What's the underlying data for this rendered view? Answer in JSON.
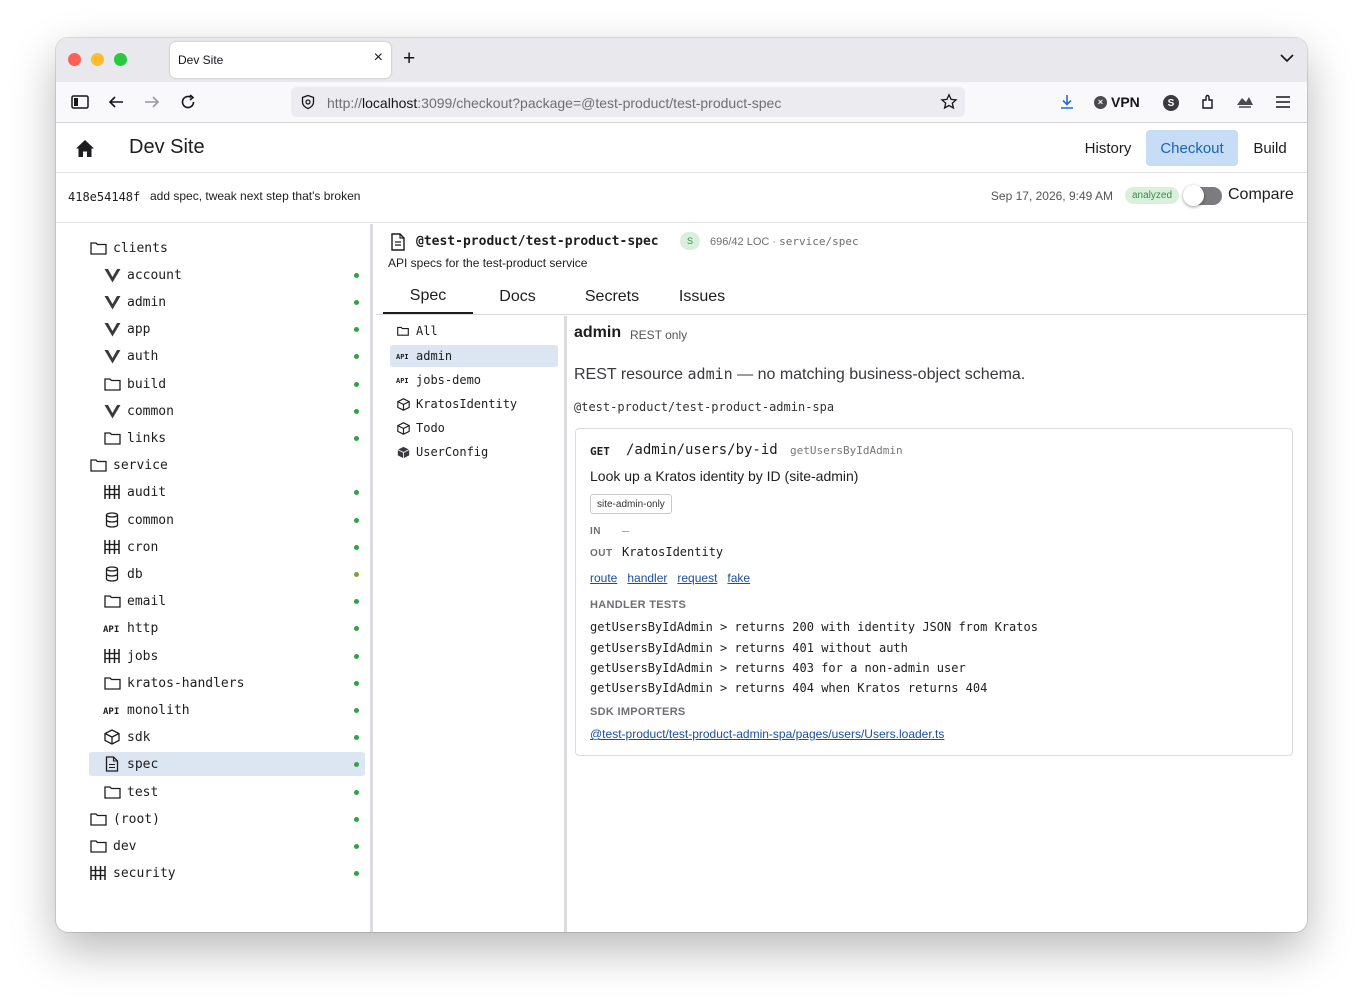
{
  "browser": {
    "tab_title": "Dev Site",
    "tab_close": "×",
    "new_tab": "+",
    "url_prefix": "http://",
    "url_host": "localhost",
    "url_rest": ":3099/checkout?package=@test-product/test-product-spec",
    "vpn_label": "VPN",
    "vpn_glyph": "×",
    "avatar_letter": "S"
  },
  "header": {
    "title": "Dev Site",
    "nav": [
      {
        "label": "History"
      },
      {
        "label": "Checkout",
        "active": true
      },
      {
        "label": "Build"
      }
    ]
  },
  "commit": {
    "sha": "418e54148f",
    "message": "add spec, tweak next step that's broken",
    "date": "Sep 17, 2026, 9:49 AM",
    "status": "analyzed",
    "compare_label": "Compare",
    "compare_enabled": false
  },
  "tree": [
    {
      "label": "clients",
      "icon": "folder-icon",
      "level": 0,
      "dot": false
    },
    {
      "label": "account",
      "icon": "vue-icon",
      "level": 1,
      "dot": true
    },
    {
      "label": "admin",
      "icon": "vue-icon",
      "level": 1,
      "dot": true
    },
    {
      "label": "app",
      "icon": "vue-icon",
      "level": 1,
      "dot": true
    },
    {
      "label": "auth",
      "icon": "vue-icon",
      "level": 1,
      "dot": true
    },
    {
      "label": "build",
      "icon": "folder-icon",
      "level": 1,
      "dot": true
    },
    {
      "label": "common",
      "icon": "vue-icon",
      "level": 1,
      "dot": true
    },
    {
      "label": "links",
      "icon": "folder-icon",
      "level": 1,
      "dot": true
    },
    {
      "label": "service",
      "icon": "folder-icon",
      "level": 0,
      "dot": false
    },
    {
      "label": "audit",
      "icon": "columns-icon",
      "level": 1,
      "dot": true
    },
    {
      "label": "common",
      "icon": "database-icon",
      "level": 1,
      "dot": true
    },
    {
      "label": "cron",
      "icon": "columns-icon",
      "level": 1,
      "dot": true
    },
    {
      "label": "db",
      "icon": "database-icon",
      "level": 1,
      "dot": true,
      "olive": true
    },
    {
      "label": "email",
      "icon": "folder-icon",
      "level": 1,
      "dot": true
    },
    {
      "label": "http",
      "icon": "api-icon",
      "level": 1,
      "dot": true
    },
    {
      "label": "jobs",
      "icon": "columns-icon",
      "level": 1,
      "dot": true
    },
    {
      "label": "kratos-handlers",
      "icon": "folder-icon",
      "level": 1,
      "dot": true
    },
    {
      "label": "monolith",
      "icon": "api-icon",
      "level": 1,
      "dot": true
    },
    {
      "label": "sdk",
      "icon": "cube-icon",
      "level": 1,
      "dot": true
    },
    {
      "label": "spec",
      "icon": "file-icon",
      "level": 1,
      "dot": true,
      "selected": true
    },
    {
      "label": "test",
      "icon": "folder-icon",
      "level": 1,
      "dot": true
    },
    {
      "label": "(root)",
      "icon": "folder-icon",
      "level": 0,
      "dot": true
    },
    {
      "label": "dev",
      "icon": "folder-icon",
      "level": 0,
      "dot": true
    },
    {
      "label": "security",
      "icon": "columns-icon",
      "level": 0,
      "dot": true
    }
  ],
  "package": {
    "name": "@test-product/test-product-spec",
    "badge": "S",
    "loc": "696/42 LOC",
    "sep": " · ",
    "path": "service/spec",
    "description": "API specs for the test-product service",
    "tabs": [
      {
        "label": "Spec",
        "active": true
      },
      {
        "label": "Docs"
      },
      {
        "label": "Secrets"
      },
      {
        "label": "Issues"
      }
    ]
  },
  "spec_list": [
    {
      "label": "All",
      "icon": "folder-icon"
    },
    {
      "label": "admin",
      "icon": "api-icon",
      "selected": true
    },
    {
      "label": "jobs-demo",
      "icon": "api-icon"
    },
    {
      "label": "KratosIdentity",
      "icon": "cube-outline-icon"
    },
    {
      "label": "Todo",
      "icon": "cube-outline-icon"
    },
    {
      "label": "UserConfig",
      "icon": "cube-solid-icon"
    }
  ],
  "resource": {
    "name": "admin",
    "subtitle": "REST only",
    "msg_pre": "REST resource ",
    "msg_code": "admin",
    "msg_post": " — no matching business-object schema.",
    "package": "@test-product/test-product-admin-spa"
  },
  "endpoint": {
    "method": "GET",
    "path": "/admin/users/by-id",
    "operation_id": "getUsersByIdAdmin",
    "summary": "Look up a Kratos identity by ID (site-admin)",
    "tag": "site-admin-only",
    "in_label": "IN",
    "in_value": "—",
    "out_label": "OUT",
    "out_value": "KratosIdentity",
    "links": [
      "route",
      "handler",
      "request",
      "fake"
    ],
    "handler_tests_title": "HANDLER TESTS",
    "handler_tests": [
      "getUsersByIdAdmin > returns 200 with identity JSON from Kratos",
      "getUsersByIdAdmin > returns 401 without auth",
      "getUsersByIdAdmin > returns 403 for a non-admin user",
      "getUsersByIdAdmin > returns 404 when Kratos returns 404"
    ],
    "sdk_importers_title": "SDK IMPORTERS",
    "sdk_importers": [
      "@test-product/test-product-admin-spa/pages/users/Users.loader.ts"
    ]
  },
  "colors": {
    "accent": "#1a63b8",
    "active_nav_bg": "#c7dcf5",
    "status_ok": "#33a04a",
    "link": "#1a4fa0"
  }
}
